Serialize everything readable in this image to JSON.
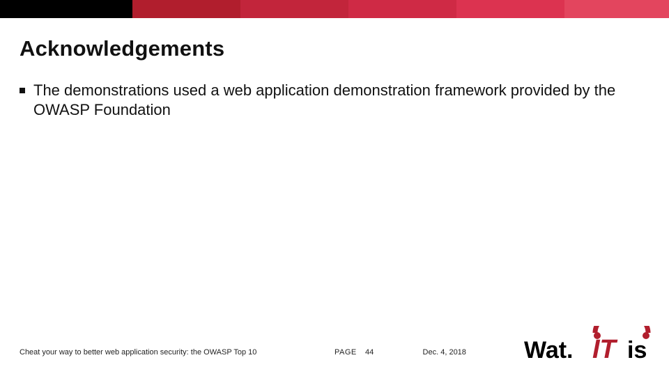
{
  "title": "Acknowledgements",
  "bullets": [
    "The demonstrations used a web application demonstration framework provided by the OWASP Foundation"
  ],
  "footer": {
    "left": "Cheat your way to better web application security: the OWASP Top 10",
    "page_label": "PAGE",
    "page_number": "44",
    "date": "Dec. 4, 2018"
  },
  "brand": {
    "logo_text_prefix": "Wat.",
    "logo_text_red": "IT",
    "logo_text_suffix": "is"
  },
  "colors": {
    "black": "#000000",
    "red_primary": "#b11e2d",
    "red_accent": "#cf2a45",
    "text": "#111111"
  }
}
